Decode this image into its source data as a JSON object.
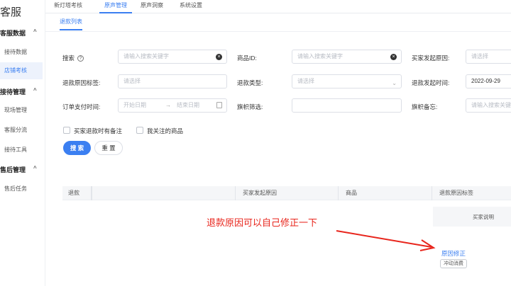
{
  "sidebar": {
    "brand": "客服",
    "groups": [
      {
        "label": "客服数据",
        "items": [
          "接待数据",
          "店铺考核"
        ]
      },
      {
        "label": "接待管理",
        "items": [
          "现场管理",
          "客服分流",
          "接待工具"
        ]
      },
      {
        "label": "售后管理",
        "items": [
          "售后任务"
        ]
      }
    ],
    "collapse_glyph": "^"
  },
  "topnav": {
    "tabs": [
      "新灯塔考核",
      "原声管理",
      "原声洞察",
      "系统设置"
    ],
    "active": "原声管理"
  },
  "subnav": {
    "tab": "退款列表"
  },
  "filters": {
    "search": {
      "label": "搜索",
      "help": "?",
      "placeholder": "请输入搜索关键字"
    },
    "product_id": {
      "label": "商品ID:",
      "placeholder": "请输入搜索关键字"
    },
    "buyer_reason": {
      "label": "买家发起原因:",
      "placeholder": "请选择"
    },
    "refund_tag": {
      "label": "退款原因标签:",
      "placeholder": "请选择"
    },
    "refund_type": {
      "label": "退款类型:",
      "placeholder": "请选择"
    },
    "refund_time": {
      "label": "退款发起时间:",
      "value": "2022-09-29"
    },
    "pay_time": {
      "label": "订单支付时间:",
      "start_placeholder": "开始日期",
      "arrow": "→",
      "end_placeholder": "结束日期"
    },
    "flag_filter": {
      "label": "旗帜筛选:",
      "value": ""
    },
    "flag_note": {
      "label": "旗帜备忘:",
      "placeholder": "请输入搜索关键字"
    },
    "checkboxes": [
      "买家退款时有备注",
      "我关注的商品"
    ],
    "search_button": "搜 索",
    "reset_button": "重 置"
  },
  "table": {
    "columns": [
      "退款",
      "买家发起原因",
      "商品",
      "退款原因标签"
    ],
    "subheader": "买家说明",
    "row": {
      "action_link": "原因修正",
      "tag": "冲动消费"
    }
  },
  "annotation": {
    "text": "退款原因可以自己修正一下",
    "color": "#e8251c"
  },
  "colors": {
    "accent": "#3b7ff1"
  }
}
